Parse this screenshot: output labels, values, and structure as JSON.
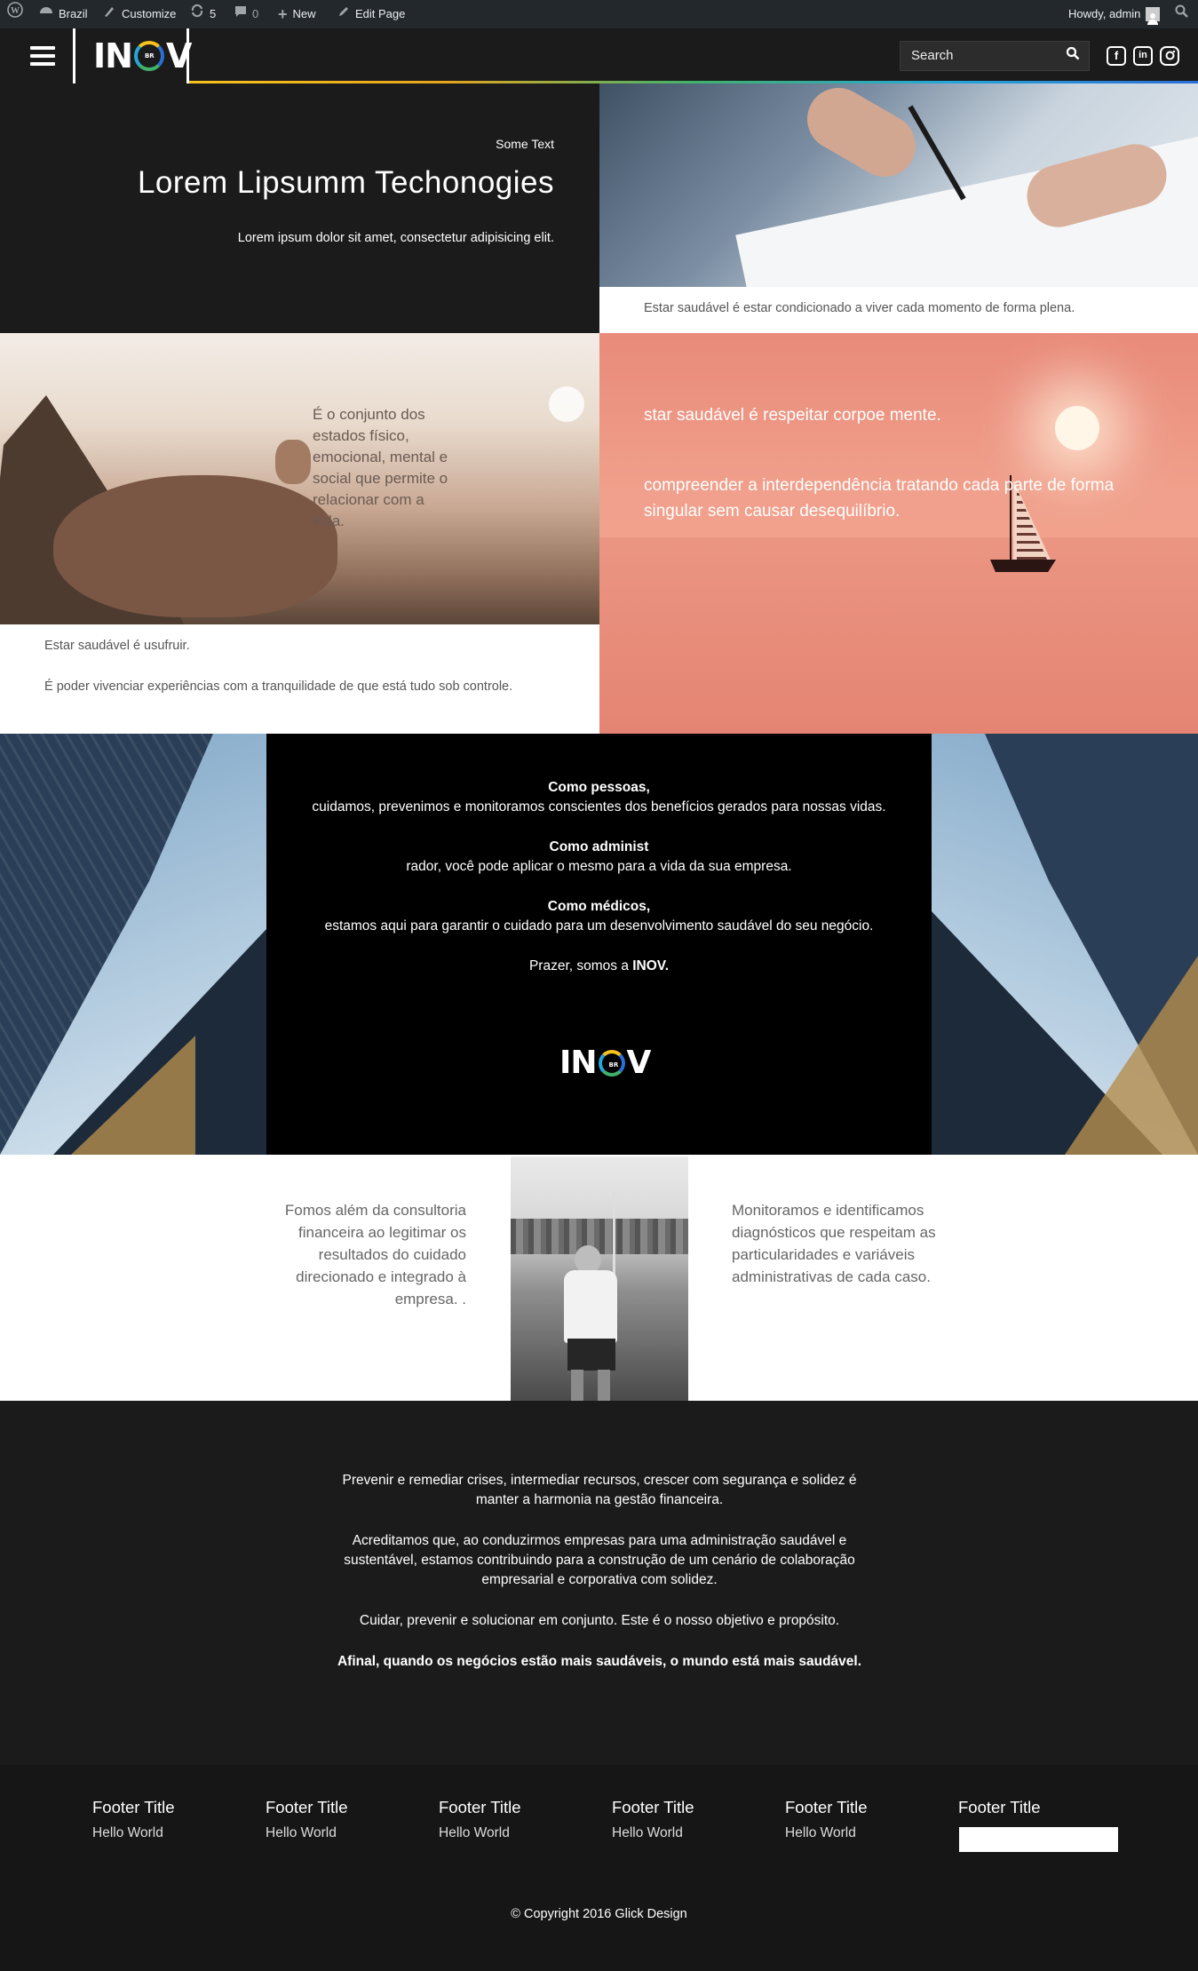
{
  "adminbar": {
    "site_name": "Brazil",
    "customize": "Customize",
    "updates_count": "5",
    "comments_count": "0",
    "new_label": "New",
    "edit_page": "Edit Page",
    "howdy": "Howdy, admin"
  },
  "header": {
    "logo_left": "IN",
    "logo_ring_small": "BR",
    "logo_right": "V",
    "search_placeholder": "Search"
  },
  "hero": {
    "kicker": "Some Text",
    "title": "Lorem Lipsumm Techonogies",
    "subtitle": "Lorem ipsum dolor sit amet, consectetur adipisicing elit.",
    "caption": "Estar saudável é estar condicionado a viver cada momento de forma plena."
  },
  "rock": {
    "overlay_text": "É o conjunto dos estados físico, emocional, mental e social que permite o relacionar com a vida.",
    "line1": "Estar saudável é usufruir.",
    "line2": "É poder vivenciar experiências com a tranquilidade de que está tudo sob controle."
  },
  "sunset": {
    "line1": "star saudável é respeitar corpoe mente.",
    "line2": "compreender a interdependência tratando cada parte de forma singular sem causar desequilíbrio."
  },
  "black_box": {
    "p1_bold": "Como pessoas,",
    "p1_text": "cuidamos, prevenimos e monitoramos conscientes dos benefícios gerados para nossas vidas.",
    "p2_bold": "Como administ",
    "p2_text": "rador, você pode aplicar o mesmo para a vida da sua empresa.",
    "p3_bold": "Como médicos,",
    "p3_text": "estamos aqui para garantir o cuidado para um desenvolvimento saudável do seu negócio.",
    "p4_text": "Prazer, somos a ",
    "p4_bold": "INOV."
  },
  "row4": {
    "left_text": "Fomos além da consultoria financeira ao legitimar os resultados do cuidado direcionado e integrado à empresa. .",
    "right_text": "Monitoramos e identificamos diagnósticos que respeitam as particularidades e variáveis administrativas de cada caso."
  },
  "dark": {
    "p1": "Prevenir e remediar crises, intermediar recursos, crescer com segurança e solidez é manter a harmonia na gestão financeira.",
    "p2": "Acreditamos que, ao conduzirmos empresas para uma administração saudável e sustentável, estamos contribuindo para a construção de um cenário de colaboração empresarial e corporativa com solidez.",
    "p3": "Cuidar, prevenir e solucionar em conjunto. Este é o nosso objetivo e propósito.",
    "p4": "Afinal, quando os negócios estão mais saudáveis, o mundo está mais saudável."
  },
  "footer": {
    "columns": [
      {
        "title": "Footer Title",
        "text": "Hello World"
      },
      {
        "title": "Footer Title",
        "text": "Hello World"
      },
      {
        "title": "Footer Title",
        "text": "Hello World"
      },
      {
        "title": "Footer Title",
        "text": "Hello World"
      },
      {
        "title": "Footer Title",
        "text": "Hello World"
      },
      {
        "title": "Footer Title",
        "text": ""
      }
    ],
    "copyright": "© Copyright 2016 Glick Design"
  },
  "colors": {
    "dark_bg": "#1b1b1b",
    "admin_bar": "#23282d",
    "accent_yellow": "#f7c21d",
    "accent_green": "#3fb36b",
    "accent_blue": "#2a6fd6"
  },
  "icons": [
    "wordpress-icon",
    "dashboard-icon",
    "brush-icon",
    "updates-icon",
    "comment-icon",
    "plus-icon",
    "pencil-icon",
    "avatar-icon",
    "search-icon",
    "menu-icon",
    "facebook-icon",
    "linkedin-icon",
    "instagram-icon"
  ]
}
